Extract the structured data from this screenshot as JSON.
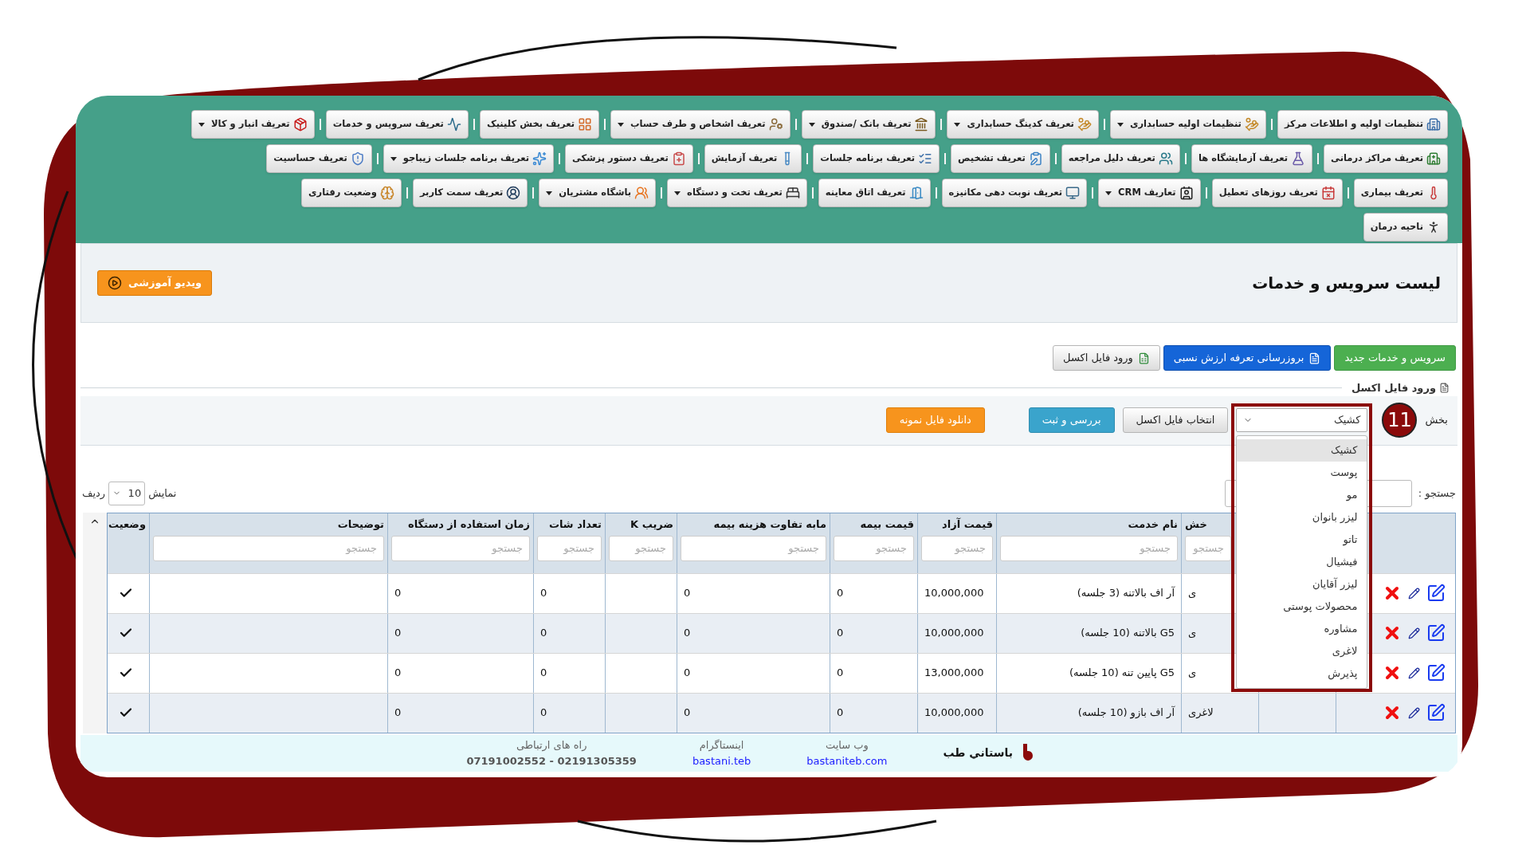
{
  "menu": {
    "rows": [
      {
        "items": [
          {
            "label": "تنظیمات اولیه و اطلاعات مرکز",
            "dropdown": false
          },
          {
            "label": "تنظیمات اولیه حسابداری",
            "dropdown": true
          },
          {
            "label": "تعریف کدینگ حسابداری",
            "dropdown": true
          },
          {
            "label": "تعریف بانک /صندوق",
            "dropdown": true
          },
          {
            "label": "تعریف اشخاص و طرف حساب",
            "dropdown": true
          },
          {
            "label": "تعریف بخش کلینیک",
            "dropdown": false
          },
          {
            "label": "تعریف سرویس و خدمات",
            "dropdown": false
          },
          {
            "label": "تعریف انبار و کالا",
            "dropdown": true
          }
        ]
      },
      {
        "items": [
          {
            "label": "تعریف مراکز درمانی",
            "dropdown": false
          },
          {
            "label": "تعریف آزمایشگاه ها",
            "dropdown": false
          },
          {
            "label": "تعریف دلیل مراجعه",
            "dropdown": false
          },
          {
            "label": "تعریف تشخیص",
            "dropdown": false
          },
          {
            "label": "تعریف برنامه جلسات",
            "dropdown": false
          },
          {
            "label": "تعریف آزمایش",
            "dropdown": false
          },
          {
            "label": "تعریف دستور پزشکی",
            "dropdown": false
          },
          {
            "label": "تعریف برنامه جلسات زیباجو",
            "dropdown": true
          },
          {
            "label": "تعریف حساسیت",
            "dropdown": false
          }
        ]
      },
      {
        "items": [
          {
            "label": "تعریف بیماری",
            "dropdown": false
          },
          {
            "label": "تعریف روزهای تعطیل",
            "dropdown": false
          },
          {
            "label": "تعاریف CRM",
            "dropdown": true
          },
          {
            "label": "تعریف نوبت دهی مکانیزه",
            "dropdown": false
          },
          {
            "label": "تعریف اتاق معاینه",
            "dropdown": false
          },
          {
            "label": "تعریف تخت و دستگاه",
            "dropdown": true
          },
          {
            "label": "باشگاه مشتریان",
            "dropdown": true
          },
          {
            "label": "تعریف سمت کاربر",
            "dropdown": false
          },
          {
            "label": "وضعیت رفتاری",
            "dropdown": false
          }
        ]
      },
      {
        "items": [
          {
            "label": "ناحیه درمان",
            "dropdown": false
          }
        ]
      }
    ]
  },
  "page_title": "لیست سرویس و خدمات",
  "video_button": "ویدیو آموزشی",
  "actions": [
    {
      "label": "سرویس و خدمات جدید",
      "kind": "success"
    },
    {
      "label": "بروزرسانی تعرفه ارزش نسبی",
      "kind": "primary"
    },
    {
      "label": "ورود فایل اکسل",
      "kind": "default"
    }
  ],
  "import": {
    "legend": "ورود فایل اکسل",
    "field_label": "بخش",
    "select": {
      "value": "کشیک",
      "expanded": true,
      "options": [
        {
          "label": "کشیک",
          "selected": true
        },
        {
          "label": "پوست",
          "selected": false
        },
        {
          "label": "مو",
          "selected": false
        },
        {
          "label": "لیزر بانوان",
          "selected": false
        },
        {
          "label": "تاتو",
          "selected": false
        },
        {
          "label": "فیشیال",
          "selected": false
        },
        {
          "label": "لیزر آقایان",
          "selected": false
        },
        {
          "label": "محصولات پوستی",
          "selected": false
        },
        {
          "label": "مشاوره",
          "selected": false
        },
        {
          "label": "لاغری",
          "selected": false
        },
        {
          "label": "پذیرش",
          "selected": false
        }
      ]
    },
    "buttons": [
      {
        "label": "انتخاب فایل اکسل",
        "kind": "default"
      },
      {
        "label": "بررسی و ثبت",
        "kind": "info"
      },
      {
        "label": "دانلود فایل نمونه",
        "kind": "warning"
      }
    ]
  },
  "annotation": {
    "number": "11"
  },
  "table_controls": {
    "search_label": "جستجو :",
    "show_label": "نمایش",
    "page_size": "10",
    "rows_label": "ردیف"
  },
  "table": {
    "columns": [
      {},
      {
        "label": "خش",
        "placeholder": "جستجو"
      },
      {
        "label": "نام خدمت",
        "placeholder": "جستجو"
      },
      {
        "label": "قیمت آزاد",
        "placeholder": "جستجو"
      },
      {
        "label": "قیمت بیمه",
        "placeholder": "جستجو"
      },
      {
        "label": "مابه تفاوت هزینه بیمه",
        "placeholder": "جستجو"
      },
      {
        "label": "ضریب K",
        "placeholder": "جستجو"
      },
      {
        "label": "تعداد شات",
        "placeholder": "جستجو"
      },
      {
        "label": "زمان استفاده از دستگاه",
        "placeholder": "جستجو"
      },
      {
        "label": "توضیحات",
        "placeholder": "جستجو"
      },
      {
        "label": "وضعیت"
      }
    ],
    "rows": [
      {
        "cells": [
          null,
          "ی",
          "آر اف بالاتنه (3 جلسه)",
          "10,000,000",
          "0",
          "0",
          null,
          "0",
          "0",
          null
        ],
        "active": true
      },
      {
        "cells": [
          null,
          "ی",
          "G5 بالاتنه (10 جلسه)",
          "10,000,000",
          "0",
          "0",
          null,
          "0",
          "0",
          null
        ],
        "active": true
      },
      {
        "cells": [
          null,
          "ی",
          "G5 پایین تنه (10 جلسه)",
          "13,000,000",
          "0",
          "0",
          null,
          "0",
          "0",
          null
        ],
        "active": true
      },
      {
        "cells": [
          null,
          "لاغری",
          "آر اف بازو (10 جلسه)",
          "10,000,000",
          "0",
          "0",
          null,
          "0",
          "0",
          null
        ],
        "active": true
      }
    ]
  },
  "footer": {
    "brand": "باستاني طب",
    "links": [
      {
        "title": "وب سایت",
        "value": "bastaniteb.com",
        "kind": "link"
      },
      {
        "title": "اینستاگرام",
        "value": "bastani.teb",
        "kind": "link"
      },
      {
        "title": "راه های ارتباطی",
        "value": "07191002552 - 02191305359",
        "kind": "text"
      }
    ]
  }
}
